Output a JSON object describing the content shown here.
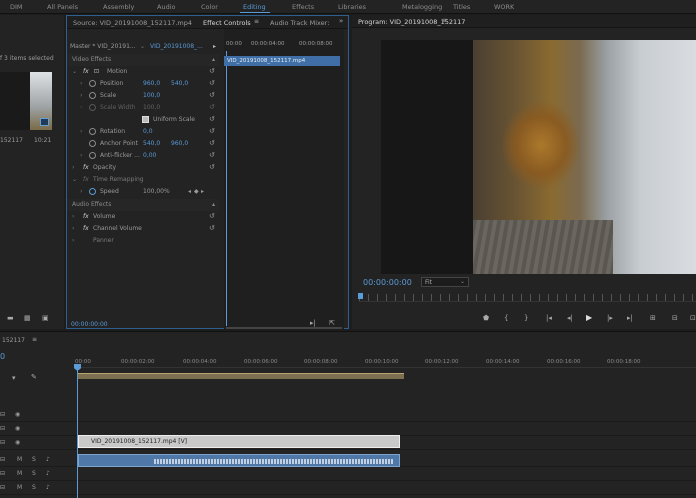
{
  "workspaces": [
    {
      "label": "DIM"
    },
    {
      "label": "All Panels"
    },
    {
      "label": "Assembly"
    },
    {
      "label": "Audio"
    },
    {
      "label": "Color"
    },
    {
      "label": "Editing"
    },
    {
      "label": "Effects"
    },
    {
      "label": "Libraries"
    },
    {
      "label": "Metalogging"
    },
    {
      "label": "Titles"
    },
    {
      "label": "WORK"
    }
  ],
  "active_workspace": "Editing",
  "project": {
    "selection_text": "f 3 items selected",
    "clip_name": "152117",
    "clip_duration": "10:21"
  },
  "effect_controls": {
    "tabs": {
      "source": "Source: VID_20191008_152117.mp4",
      "effect_controls": "Effect Controls",
      "audio_mixer": "Audio Track Mixer:"
    },
    "master_label": "Master * VID_20191...",
    "sequence_label": "VID_20191008_...",
    "mini_timecodes": [
      "00:00",
      "00:00:04:00",
      "00:00:08:00"
    ],
    "clip_bar_label": "VID_20191008_152117.mp4",
    "video_effects_label": "Video Effects",
    "motion_label": "Motion",
    "position_label": "Position",
    "position_x": "960,0",
    "position_y": "540,0",
    "scale_label": "Scale",
    "scale_value": "100,0",
    "scale_width_label": "Scale Width",
    "scale_width_value": "100,0",
    "uniform_scale_label": "Uniform Scale",
    "rotation_label": "Rotation",
    "rotation_value": "0,0",
    "anchor_label": "Anchor Point",
    "anchor_x": "540,0",
    "anchor_y": "960,0",
    "antiflicker_label": "Anti-flicker ...",
    "antiflicker_value": "0,00",
    "opacity_label": "Opacity",
    "time_remap_label": "Time Remapping",
    "speed_label": "Speed",
    "speed_value": "100,00%",
    "audio_effects_label": "Audio Effects",
    "volume_label": "Volume",
    "channel_volume_label": "Channel Volume",
    "panner_label": "Panner",
    "bottom_timecode": "00:00:00:00"
  },
  "program": {
    "title": "Program: VID_20191008_152117",
    "timecode": "00:00:00:00",
    "fit_label": "Fit"
  },
  "timeline": {
    "sequence_name": "152117",
    "timecode": "0",
    "ruler_ticks": [
      "00:00",
      "00:00:02:00",
      "00:00:04:00",
      "00:00:06:00",
      "00:00:08:00",
      "00:00:10:00",
      "00:00:12:00",
      "00:00:14:00",
      "00:00:16:00",
      "00:00:18:00"
    ],
    "video_clip_label": "VID_20191008_152117.mp4 [V]",
    "track_m": "M",
    "track_s": "S"
  },
  "colors": {
    "accent": "#5b9bd8",
    "panel": "#232323",
    "audio_clip": "#4f78a8",
    "video_clip": "#c9c9c9"
  }
}
